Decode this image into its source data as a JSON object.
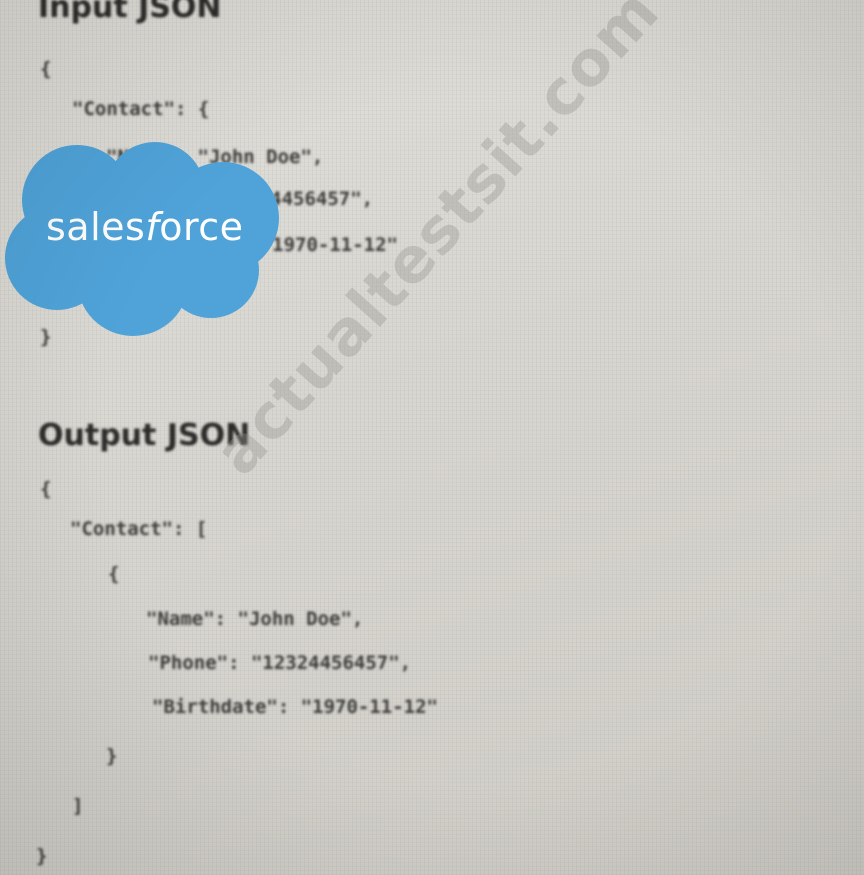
{
  "input_section": {
    "title": "Input JSON",
    "lines": [
      "{",
      "\"Contact\": {",
      "\"Name\": \"John Doe\",",
      "\"Phone\": \"12324456457\",",
      "\"Birthdate\": \"1970-11-12\"",
      "}",
      "}"
    ]
  },
  "output_section": {
    "title": "Output JSON",
    "lines": [
      "{",
      "\"Contact\": [",
      "{",
      "\"Name\": \"John Doe\",",
      "\"Phone\": \"12324456457\",",
      "\"Birthdate\": \"1970-11-12\"",
      "}",
      "]",
      "}"
    ]
  },
  "logo": {
    "text_before": "sales",
    "text_italic": "f",
    "text_after": "orce",
    "color": "#4fa3d9"
  },
  "watermark": {
    "text": "actualtestsit.com"
  }
}
